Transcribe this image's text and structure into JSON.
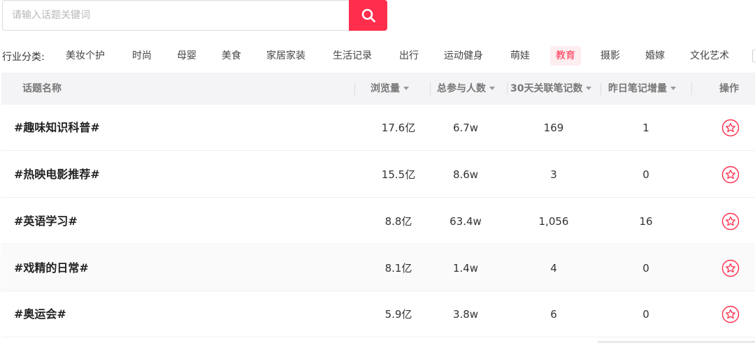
{
  "search": {
    "placeholder": "请输入话题关键词",
    "icon": "search-icon"
  },
  "categories": {
    "label": "行业分类:",
    "items": [
      "美妆个护",
      "时尚",
      "母婴",
      "美食",
      "家居家装",
      "生活记录",
      "出行",
      "运动健身",
      "萌娃",
      "教育",
      "摄影",
      "婚嫁",
      "文化艺术"
    ],
    "active": "教育"
  },
  "table": {
    "headers": {
      "topic": "话题名称",
      "views": "浏览量",
      "participants": "总参与人数",
      "notes30": "30天关联笔记数",
      "notes_yesterday": "昨日笔记增量",
      "action": "操作"
    },
    "rows": [
      {
        "topic": "#趣味知识科普#",
        "views": "17.6亿",
        "participants": "6.7w",
        "notes30": "169",
        "notes_yesterday": "1"
      },
      {
        "topic": "#热映电影推荐#",
        "views": "15.5亿",
        "participants": "8.6w",
        "notes30": "3",
        "notes_yesterday": "0"
      },
      {
        "topic": "#英语学习#",
        "views": "8.8亿",
        "participants": "63.4w",
        "notes30": "1,056",
        "notes_yesterday": "16"
      },
      {
        "topic": "#戏精的日常#",
        "views": "8.1亿",
        "participants": "1.4w",
        "notes30": "4",
        "notes_yesterday": "0"
      },
      {
        "topic": "#奥运会#",
        "views": "5.9亿",
        "participants": "3.8w",
        "notes30": "6",
        "notes_yesterday": "0"
      }
    ]
  },
  "colors": {
    "accent": "#ff2e4d",
    "header_bg": "#f4f4f6"
  }
}
